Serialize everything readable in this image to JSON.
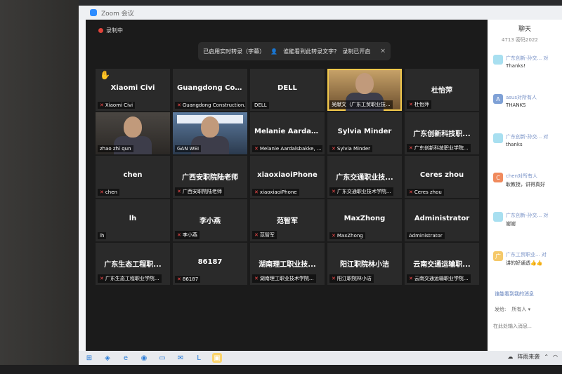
{
  "titlebar": {
    "title": "Zoom 会议"
  },
  "recording": {
    "label": "录制中"
  },
  "banner": {
    "text": "已启用实时转录（字幕）",
    "question": "谁能看到此转录文字?",
    "recording_note": "录制已开启",
    "close": "×"
  },
  "tiles": [
    {
      "name": "Xiaomi Civi",
      "label": "Xiaomi Civi",
      "video": false,
      "hand": true,
      "mic_off": true
    },
    {
      "name": "Guangdong Con...",
      "label": "Guangdong Construction...",
      "video": false,
      "hand": false,
      "mic_off": true
    },
    {
      "name": "DELL",
      "label": "DELL",
      "video": false,
      "hand": false,
      "mic_off": false
    },
    {
      "name": "",
      "label": "吴献文（广东工贸职业技...",
      "video": true,
      "style": "orange",
      "hand": false,
      "mic_off": false,
      "highlight": true
    },
    {
      "name": "杜怡萍",
      "label": "杜怡萍",
      "video": false,
      "hand": false,
      "mic_off": true
    },
    {
      "name": "",
      "label": "zhao zhi qun",
      "video": true,
      "style": "dark",
      "hand": false,
      "mic_off": false
    },
    {
      "name": "",
      "label": "GAN WEI",
      "video": true,
      "style": "blue",
      "hand": false,
      "mic_off": false
    },
    {
      "name": "Melanie Aardals...",
      "label": "Melanie Aardalsbakke, ...",
      "video": false,
      "hand": false,
      "mic_off": true
    },
    {
      "name": "Sylvia Minder",
      "label": "Sylvia Minder",
      "video": false,
      "hand": false,
      "mic_off": true
    },
    {
      "name": "广东创新科技职...",
      "label": "广东创新科技职业学院...",
      "video": false,
      "hand": false,
      "mic_off": true
    },
    {
      "name": "chen",
      "label": "chen",
      "video": false,
      "hand": false,
      "mic_off": true
    },
    {
      "name": "广西安职院陆老师",
      "label": "广西安职院陆老师",
      "video": false,
      "hand": false,
      "mic_off": true
    },
    {
      "name": "xiaoxiaoiPhone",
      "label": "xiaoxiaoiPhone",
      "video": false,
      "hand": false,
      "mic_off": true
    },
    {
      "name": "广东交通职业技...",
      "label": "广东交通职业技术学院...",
      "video": false,
      "hand": false,
      "mic_off": true
    },
    {
      "name": "Ceres zhou",
      "label": "Ceres zhou",
      "video": false,
      "hand": false,
      "mic_off": true
    },
    {
      "name": "lh",
      "label": "lh",
      "video": false,
      "hand": false,
      "mic_off": false
    },
    {
      "name": "李小燕",
      "label": "李小燕",
      "video": false,
      "hand": false,
      "mic_off": true
    },
    {
      "name": "范智军",
      "label": "范智军",
      "video": false,
      "hand": false,
      "mic_off": true
    },
    {
      "name": "MaxZhong",
      "label": "MaxZhong",
      "video": false,
      "hand": false,
      "mic_off": true
    },
    {
      "name": "Administrator",
      "label": "Administrator",
      "video": false,
      "hand": false,
      "mic_off": false
    },
    {
      "name": "广东生态工程职...",
      "label": "广东生态工程职业学院...",
      "video": false,
      "hand": false,
      "mic_off": true
    },
    {
      "name": "86187",
      "label": "86187",
      "video": false,
      "hand": false,
      "mic_off": true
    },
    {
      "name": "湖南理工职业技...",
      "label": "湖南理工职业技术学院...",
      "video": false,
      "hand": false,
      "mic_off": true
    },
    {
      "name": "阳江职院林小洁",
      "label": "阳江职院林小洁",
      "video": false,
      "hand": false,
      "mic_off": true
    },
    {
      "name": "云南交通运输职...",
      "label": "云南交通运输职业学院...",
      "video": false,
      "hand": false,
      "mic_off": true
    }
  ],
  "sidebar": {
    "title": "聊天",
    "meeting_id": "4713  密码2022",
    "messages": [
      {
        "avatar": "",
        "avatar_color": "#a8dff0",
        "sender": "广东创新-孙交... 对",
        "text": "Thanks!"
      },
      {
        "avatar": "A",
        "avatar_color": "#7fa1d6",
        "sender": "asus对所有人",
        "text": "THANKS"
      },
      {
        "avatar": "",
        "avatar_color": "#a8dff0",
        "sender": "广东创新-孙交... 对",
        "text": "thanks"
      },
      {
        "avatar": "C",
        "avatar_color": "#f08a5d",
        "sender": "chen对所有人",
        "text": "耿教授，讲得真好"
      },
      {
        "avatar": "",
        "avatar_color": "#a8dff0",
        "sender": "广东创新-孙交... 对",
        "text": "谢谢"
      },
      {
        "avatar": "广",
        "avatar_color": "#f5c96a",
        "sender": "广东工贸职业... 对",
        "text": "讲的好通透👍👍"
      }
    ],
    "transcript_note": "谁能看到我的消息",
    "send_to_label": "发给:",
    "send_to_value": "所有人 ▾",
    "input_placeholder": "在此处输入消息..."
  },
  "taskbar": {
    "icons": [
      "windows-icon",
      "widgets-icon",
      "edge-icon",
      "explorer-icon",
      "files-icon",
      "mail-icon",
      "lark-icon",
      "zoom-icon"
    ],
    "weather": "阵雨来袭"
  }
}
